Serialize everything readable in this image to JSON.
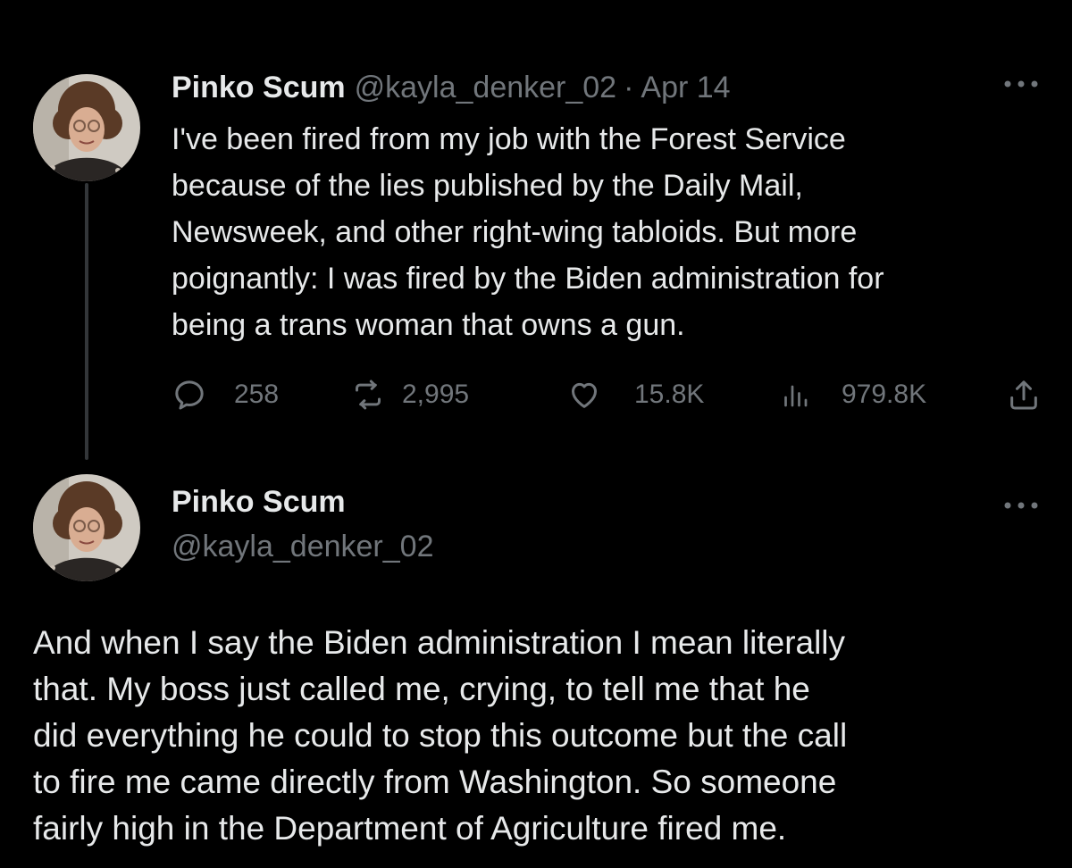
{
  "tweet": {
    "display_name": "Pinko Scum",
    "handle": "@kayla_denker_02",
    "separator": "·",
    "date": "Apr 14",
    "text": "I've been fired from my job with the Forest Service\nbecause of the lies published by the Daily Mail,\nNewsweek, and other right-wing tabloids. But more\npoignantly: I was fired by the Biden administration for\nbeing a trans woman that owns a gun.",
    "more_icon": "more-options-icon",
    "metrics": {
      "replies": "258",
      "retweets": "2,995",
      "likes": "15.8K",
      "views": "979.8K"
    }
  },
  "reply": {
    "display_name": "Pinko Scum",
    "handle": "@kayla_denker_02",
    "text": "And when I say the Biden administration I mean literally\nthat. My boss just called me, crying, to tell me that he\ndid everything he could to stop this outcome but the call\nto fire me came directly from Washington. So someone\nfairly high in the Department of Agriculture fired me."
  },
  "colors": {
    "background": "#000000",
    "text_primary": "#e7e9ea",
    "text_secondary": "#71767b",
    "thread_line": "#333639"
  }
}
